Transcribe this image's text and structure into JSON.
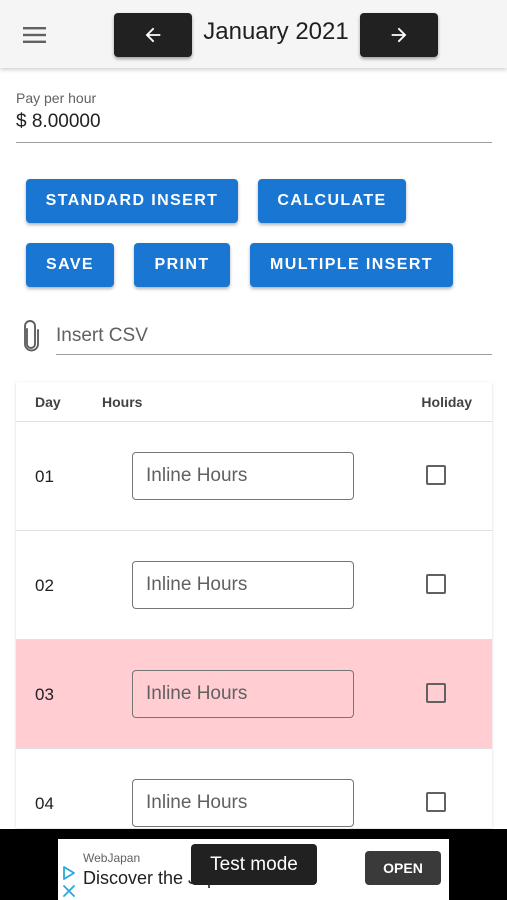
{
  "header": {
    "month_title": "January 2021",
    "menu_icon": "hamburger-menu-icon",
    "prev_icon": "arrow-left-icon",
    "next_icon": "arrow-right-icon"
  },
  "pay": {
    "label": "Pay per hour",
    "value": "$ 8.00000"
  },
  "actions": {
    "standard_insert": "STANDARD INSERT",
    "calculate": "CALCULATE",
    "save": "SAVE",
    "print": "PRINT",
    "multiple_insert": "MULTIPLE INSERT"
  },
  "csv": {
    "placeholder": "Insert CSV",
    "icon": "paperclip-icon"
  },
  "table": {
    "columns": [
      "Day",
      "Hours",
      "Holiday"
    ],
    "rows": [
      {
        "day": "01",
        "placeholder": "Inline Hours",
        "holiday": false,
        "highlighted": false
      },
      {
        "day": "02",
        "placeholder": "Inline Hours",
        "holiday": false,
        "highlighted": false
      },
      {
        "day": "03",
        "placeholder": "Inline Hours",
        "holiday": false,
        "highlighted": true
      },
      {
        "day": "04",
        "placeholder": "Inline Hours",
        "holiday": false,
        "highlighted": false
      }
    ]
  },
  "ad": {
    "brand": "WebJapan",
    "headline": "Discover the Japan",
    "open_label": "OPEN",
    "test_mode": "Test mode"
  },
  "colors": {
    "primary": "#1976d2",
    "dark_button": "#212121",
    "highlight_row": "#ffcdd2",
    "topbar": "#f5f5f5"
  }
}
